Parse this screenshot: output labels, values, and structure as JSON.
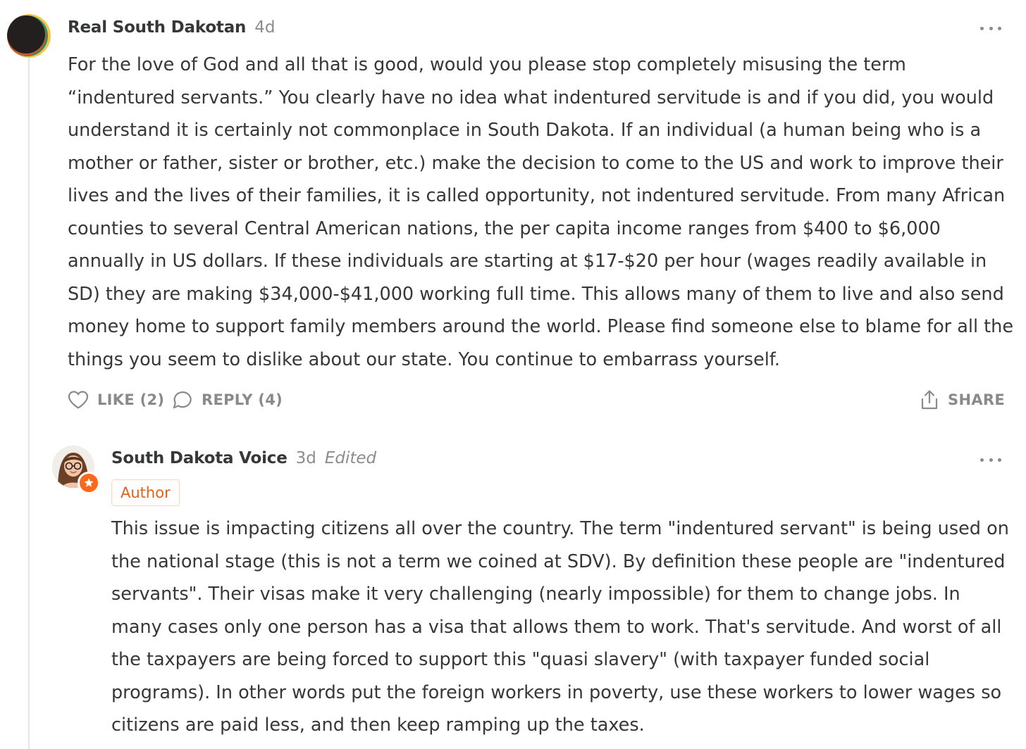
{
  "comment": {
    "author": "Real South Dakotan",
    "time": "4d",
    "body": "For the love of God and all that is good, would you please stop completely misusing the term “indentured servants.” You clearly have no idea what indentured servitude is and if you did, you would understand it is certainly not commonplace in South Dakota. If an individual (a human being who is a mother or father, sister or brother, etc.) make the decision to come to the US and work to improve their lives and the lives of their families, it is called opportunity, not indentured servitude. From many African counties to several Central American nations, the per capita income ranges from $400 to $6,000 annually in US dollars. If these individuals are starting at $17-$20 per hour (wages readily available in SD) they are making $34,000-$41,000 working full time. This allows many of them to live and also send money home to support family members around the world. Please find someone else to blame for all the things you seem to dislike about our state. You continue to embarrass yourself.",
    "actions": {
      "like": "LIKE (2)",
      "reply": "REPLY (4)",
      "share": "SHARE"
    }
  },
  "reply": {
    "author": "South Dakota Voice",
    "time": "3d",
    "edited": "Edited",
    "badge": "Author",
    "body": "This issue is impacting citizens all over the country. The term \"indentured servant\" is being used on the national stage (this is not a term we coined at SDV). By definition these people are \"indentured servants\". Their visas make it very challenging (nearly impossible) for them to change jobs. In many cases only one person has a visa that allows them to work. That's servitude. And worst of all the taxpayers are being forced to support this \"quasi slavery\" (with taxpayer funded social programs). In other words put the foreign workers in poverty, use these workers to lower wages so citizens are paid less, and then keep ramping up the taxes."
  },
  "icons": {
    "more": "more-horizontal-icon",
    "like": "heart-icon",
    "reply": "speech-bubble-icon",
    "share": "share-icon",
    "author_star": "star-icon"
  },
  "colors": {
    "text": "#363737",
    "muted": "#8c8c8c",
    "accent": "#ff6719",
    "thread_line": "#e4e4e4"
  }
}
